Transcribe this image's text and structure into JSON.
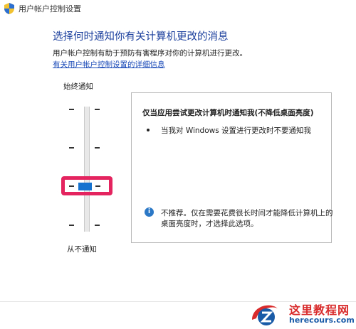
{
  "window": {
    "title": "用户帐户控制设置"
  },
  "main": {
    "heading": "选择何时通知你有关计算机更改的消息",
    "description": "用户帐户控制有助于预防有害程序对你的计算机进行更改。",
    "link": "有关用户帐户控制设置的详细信息"
  },
  "slider": {
    "top_label": "始终通知",
    "bottom_label": "从不通知",
    "levels": 4,
    "selected_level": 2
  },
  "panel": {
    "title": "仅当应用尝试更改计算机时通知我(不降低桌面亮度)",
    "bullet": "当我对 Windows 设置进行更改时不要通知我",
    "note_line1": "不推荐。仅在需要花费很长时间才能降低计算机上的",
    "note_line2": "桌面亮度时，才选择此选项。",
    "info_glyph": "i"
  },
  "watermark": {
    "name": "这里教程网",
    "url": "herecours.com"
  },
  "icons": {
    "title_icon": "uac-shield-icon",
    "info_icon": "info-icon",
    "logo_icon": "z-logo-icon"
  },
  "colors": {
    "heading": "#1b3f9c",
    "link": "#1a4ab8",
    "thumb": "#1672cf",
    "highlight": "#e3245e",
    "info": "#2b78c7",
    "watermark_red": "#d92b2b",
    "watermark_blue": "#1a5ba8"
  }
}
